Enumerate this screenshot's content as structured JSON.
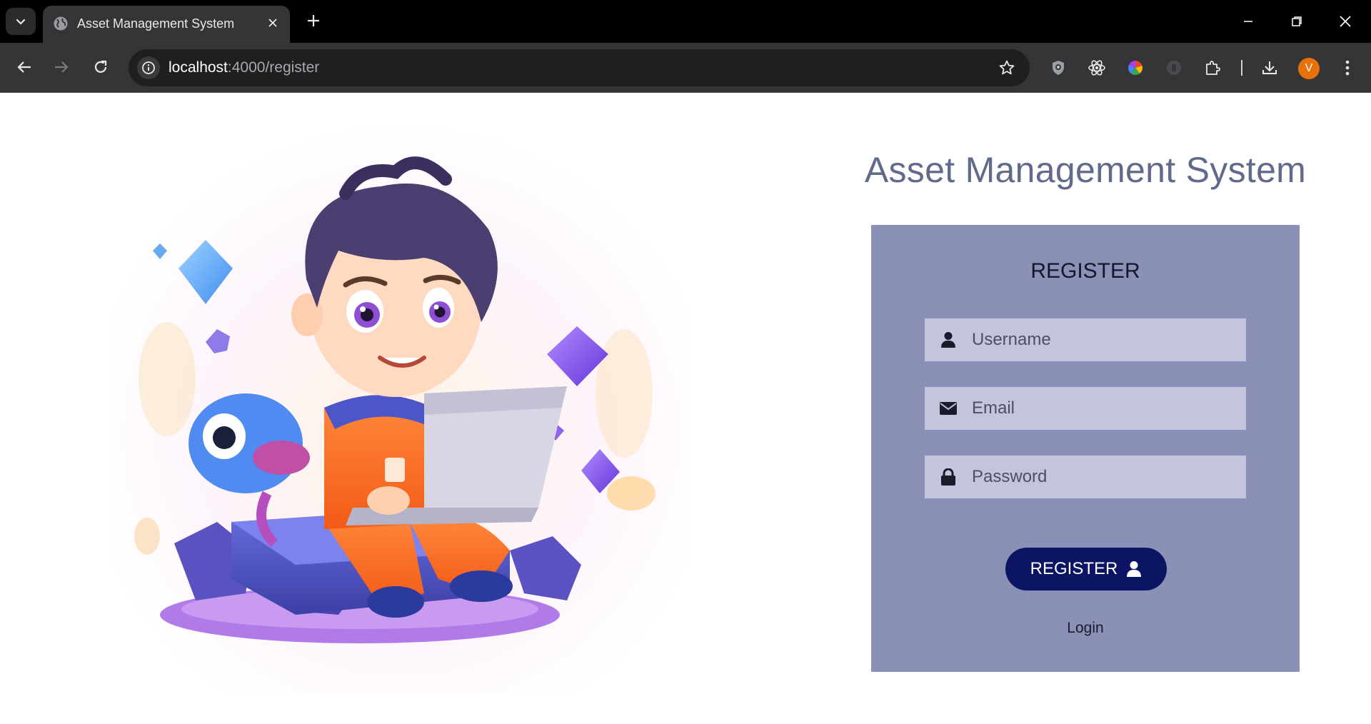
{
  "browser": {
    "tab_title": "Asset Management System",
    "url_host": "localhost",
    "url_path": ":4000/register",
    "profile_initial": "V"
  },
  "page": {
    "title": "Asset Management System",
    "form": {
      "heading": "REGISTER",
      "username_placeholder": "Username",
      "email_placeholder": "Email",
      "password_placeholder": "Password",
      "submit_label": "REGISTER",
      "login_link": "Login"
    }
  },
  "colors": {
    "card_bg": "#8b91b6",
    "field_bg": "#c2c5dc",
    "button_bg": "#0b1563",
    "title_color": "#626a8c"
  }
}
